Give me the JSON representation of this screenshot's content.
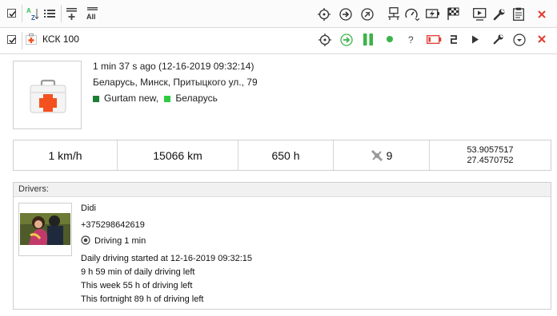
{
  "unit": {
    "name": "КСК 100",
    "last_message": "1 min 37 s ago (12-16-2019 09:32:14)",
    "address": "Беларусь, Минск, Притыцкого ул., 79",
    "groups": [
      {
        "label": "Gurtam new,",
        "color": "#1e7e34"
      },
      {
        "label": "Беларусь",
        "color": "#2ecc40"
      }
    ]
  },
  "stats": {
    "speed": "1 km/h",
    "mileage": "15066 km",
    "engine_hours": "650 h",
    "satellites": "9",
    "lat": "53.9057517",
    "lon": "27.4570752"
  },
  "drivers": {
    "header": "Drivers:",
    "name": "Didi",
    "phone": "+375298642619",
    "status": "Driving 1 min",
    "lines": [
      "Daily driving started at 12-16-2019 09:32:15",
      "9 h 59 min of daily driving left",
      "This week 55 h of driving left",
      "This fortnight 89 h of driving left"
    ]
  },
  "colors": {
    "accent_green": "#3cb34a",
    "accent_red": "#e23b2e",
    "medkit_red": "#f4511e"
  },
  "icons": {
    "toolbar": [
      "select-all-checkbox",
      "sort-az-icon",
      "list-icon",
      "add-group-icon",
      "all-icon",
      "locate-icon",
      "arrow-right-icon",
      "signal-icon",
      "network-icon",
      "speedometer-icon",
      "battery-icon",
      "flag-icon",
      "video-icon",
      "wrench-icon",
      "clipboard-icon",
      "close-icon"
    ],
    "unit_row": [
      "unit-checkbox",
      "medkit-icon",
      "locate-icon",
      "send-icon",
      "pause-icon",
      "status-dot-icon",
      "question-icon",
      "battery-low-icon",
      "driver-sensor-icon",
      "play-icon",
      "wrench-icon",
      "dropdown-icon",
      "close-icon"
    ]
  }
}
